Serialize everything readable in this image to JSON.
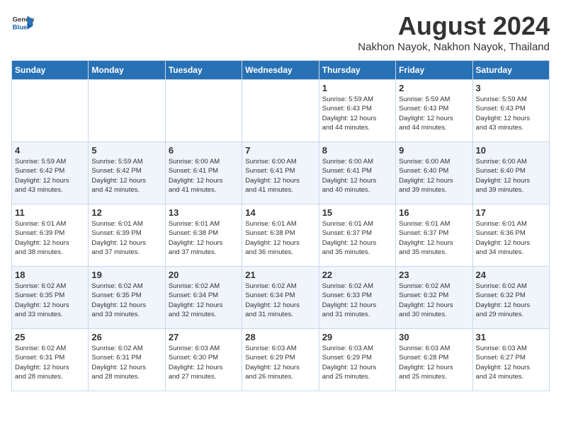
{
  "header": {
    "logo_line1": "General",
    "logo_line2": "Blue",
    "month": "August 2024",
    "location": "Nakhon Nayok, Nakhon Nayok, Thailand"
  },
  "days_of_week": [
    "Sunday",
    "Monday",
    "Tuesday",
    "Wednesday",
    "Thursday",
    "Friday",
    "Saturday"
  ],
  "weeks": [
    [
      {
        "day": "",
        "info": ""
      },
      {
        "day": "",
        "info": ""
      },
      {
        "day": "",
        "info": ""
      },
      {
        "day": "",
        "info": ""
      },
      {
        "day": "1",
        "info": "Sunrise: 5:59 AM\nSunset: 6:43 PM\nDaylight: 12 hours\nand 44 minutes."
      },
      {
        "day": "2",
        "info": "Sunrise: 5:59 AM\nSunset: 6:43 PM\nDaylight: 12 hours\nand 44 minutes."
      },
      {
        "day": "3",
        "info": "Sunrise: 5:59 AM\nSunset: 6:43 PM\nDaylight: 12 hours\nand 43 minutes."
      }
    ],
    [
      {
        "day": "4",
        "info": "Sunrise: 5:59 AM\nSunset: 6:42 PM\nDaylight: 12 hours\nand 43 minutes."
      },
      {
        "day": "5",
        "info": "Sunrise: 5:59 AM\nSunset: 6:42 PM\nDaylight: 12 hours\nand 42 minutes."
      },
      {
        "day": "6",
        "info": "Sunrise: 6:00 AM\nSunset: 6:41 PM\nDaylight: 12 hours\nand 41 minutes."
      },
      {
        "day": "7",
        "info": "Sunrise: 6:00 AM\nSunset: 6:41 PM\nDaylight: 12 hours\nand 41 minutes."
      },
      {
        "day": "8",
        "info": "Sunrise: 6:00 AM\nSunset: 6:41 PM\nDaylight: 12 hours\nand 40 minutes."
      },
      {
        "day": "9",
        "info": "Sunrise: 6:00 AM\nSunset: 6:40 PM\nDaylight: 12 hours\nand 39 minutes."
      },
      {
        "day": "10",
        "info": "Sunrise: 6:00 AM\nSunset: 6:40 PM\nDaylight: 12 hours\nand 39 minutes."
      }
    ],
    [
      {
        "day": "11",
        "info": "Sunrise: 6:01 AM\nSunset: 6:39 PM\nDaylight: 12 hours\nand 38 minutes."
      },
      {
        "day": "12",
        "info": "Sunrise: 6:01 AM\nSunset: 6:39 PM\nDaylight: 12 hours\nand 37 minutes."
      },
      {
        "day": "13",
        "info": "Sunrise: 6:01 AM\nSunset: 6:38 PM\nDaylight: 12 hours\nand 37 minutes."
      },
      {
        "day": "14",
        "info": "Sunrise: 6:01 AM\nSunset: 6:38 PM\nDaylight: 12 hours\nand 36 minutes."
      },
      {
        "day": "15",
        "info": "Sunrise: 6:01 AM\nSunset: 6:37 PM\nDaylight: 12 hours\nand 35 minutes."
      },
      {
        "day": "16",
        "info": "Sunrise: 6:01 AM\nSunset: 6:37 PM\nDaylight: 12 hours\nand 35 minutes."
      },
      {
        "day": "17",
        "info": "Sunrise: 6:01 AM\nSunset: 6:36 PM\nDaylight: 12 hours\nand 34 minutes."
      }
    ],
    [
      {
        "day": "18",
        "info": "Sunrise: 6:02 AM\nSunset: 6:35 PM\nDaylight: 12 hours\nand 33 minutes."
      },
      {
        "day": "19",
        "info": "Sunrise: 6:02 AM\nSunset: 6:35 PM\nDaylight: 12 hours\nand 33 minutes."
      },
      {
        "day": "20",
        "info": "Sunrise: 6:02 AM\nSunset: 6:34 PM\nDaylight: 12 hours\nand 32 minutes."
      },
      {
        "day": "21",
        "info": "Sunrise: 6:02 AM\nSunset: 6:34 PM\nDaylight: 12 hours\nand 31 minutes."
      },
      {
        "day": "22",
        "info": "Sunrise: 6:02 AM\nSunset: 6:33 PM\nDaylight: 12 hours\nand 31 minutes."
      },
      {
        "day": "23",
        "info": "Sunrise: 6:02 AM\nSunset: 6:32 PM\nDaylight: 12 hours\nand 30 minutes."
      },
      {
        "day": "24",
        "info": "Sunrise: 6:02 AM\nSunset: 6:32 PM\nDaylight: 12 hours\nand 29 minutes."
      }
    ],
    [
      {
        "day": "25",
        "info": "Sunrise: 6:02 AM\nSunset: 6:31 PM\nDaylight: 12 hours\nand 28 minutes."
      },
      {
        "day": "26",
        "info": "Sunrise: 6:02 AM\nSunset: 6:31 PM\nDaylight: 12 hours\nand 28 minutes."
      },
      {
        "day": "27",
        "info": "Sunrise: 6:03 AM\nSunset: 6:30 PM\nDaylight: 12 hours\nand 27 minutes."
      },
      {
        "day": "28",
        "info": "Sunrise: 6:03 AM\nSunset: 6:29 PM\nDaylight: 12 hours\nand 26 minutes."
      },
      {
        "day": "29",
        "info": "Sunrise: 6:03 AM\nSunset: 6:29 PM\nDaylight: 12 hours\nand 25 minutes."
      },
      {
        "day": "30",
        "info": "Sunrise: 6:03 AM\nSunset: 6:28 PM\nDaylight: 12 hours\nand 25 minutes."
      },
      {
        "day": "31",
        "info": "Sunrise: 6:03 AM\nSunset: 6:27 PM\nDaylight: 12 hours\nand 24 minutes."
      }
    ]
  ]
}
